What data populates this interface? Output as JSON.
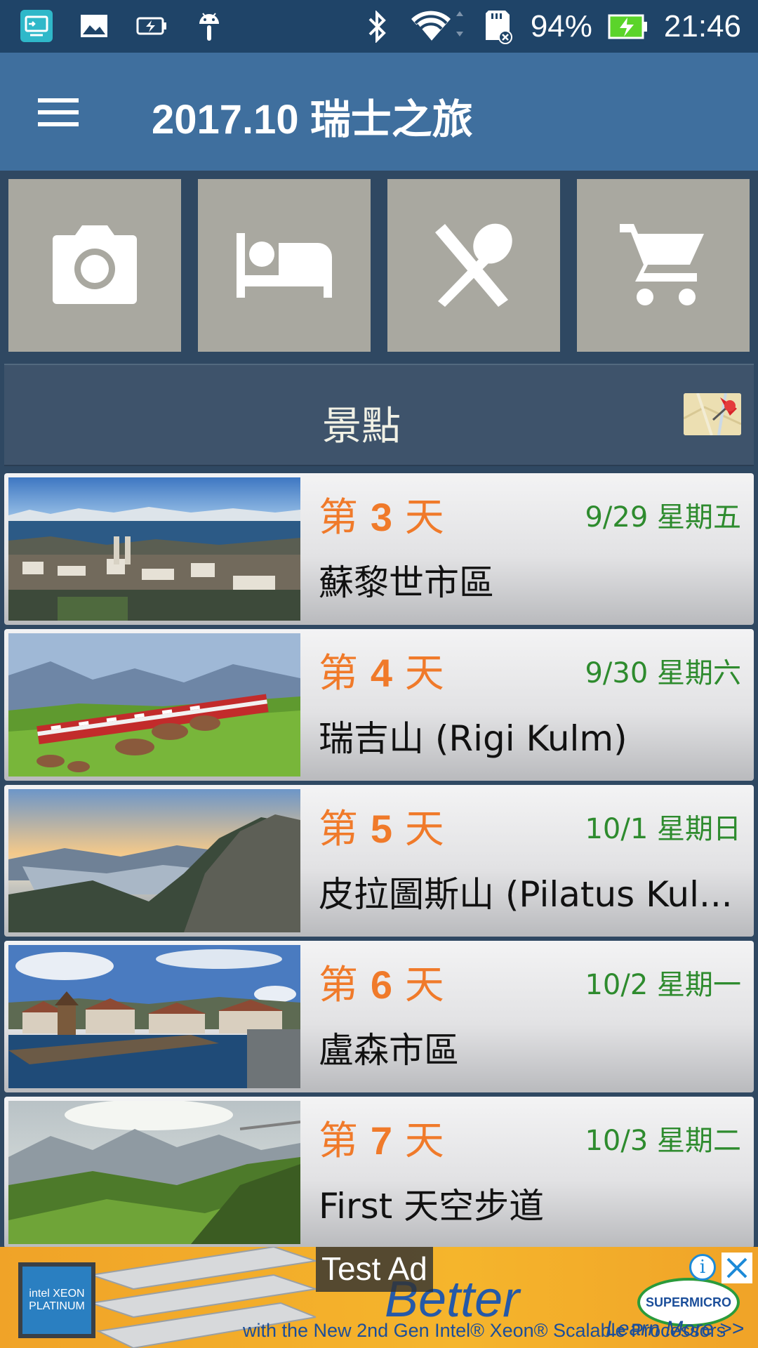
{
  "status_bar": {
    "battery_percent": "94%",
    "time": "21:46",
    "icons": [
      "screen-cast-icon",
      "image-icon",
      "battery-saver-icon",
      "android-icon",
      "bluetooth-icon",
      "wifi-icon",
      "sd-card-icon",
      "battery-charging-icon"
    ]
  },
  "app_bar": {
    "title": "2017.10 瑞士之旅",
    "menu_icon": "menu-icon"
  },
  "categories": [
    {
      "icon": "camera-icon"
    },
    {
      "icon": "bed-icon"
    },
    {
      "icon": "dining-icon"
    },
    {
      "icon": "shopping-cart-icon"
    }
  ],
  "section": {
    "title": "景點",
    "map_icon": "map-pin-icon"
  },
  "days": [
    {
      "prefix": "第 ",
      "num": "3",
      "suffix": " 天",
      "date": "9/29 星期五",
      "place": "蘇黎世市區"
    },
    {
      "prefix": "第 ",
      "num": "4",
      "suffix": " 天",
      "date": "9/30 星期六",
      "place": "瑞吉山 (Rigi Kulm)"
    },
    {
      "prefix": "第 ",
      "num": "5",
      "suffix": " 天",
      "date": "10/1 星期日",
      "place": "皮拉圖斯山 (Pilatus Kul..."
    },
    {
      "prefix": "第 ",
      "num": "6",
      "suffix": " 天",
      "date": "10/2 星期一",
      "place": "盧森市區"
    },
    {
      "prefix": "第 ",
      "num": "7",
      "suffix": " 天",
      "date": "10/3 星期二",
      "place": "First 天空步道"
    }
  ],
  "ad": {
    "label": "Test Ad",
    "headline": "Better",
    "sub": "with the New 2nd Gen Intel® Xeon® Scalable Processors",
    "cta": "Learn More >>",
    "brand": "SUPERMICRO",
    "chip_text": "intel XEON PLATINUM"
  },
  "colors": {
    "app_bar": "#3f6f9e",
    "status_bar": "#1f4468",
    "tile": "#a9a8a0",
    "day_label": "#f07a2a",
    "date": "#2e8b2e"
  }
}
